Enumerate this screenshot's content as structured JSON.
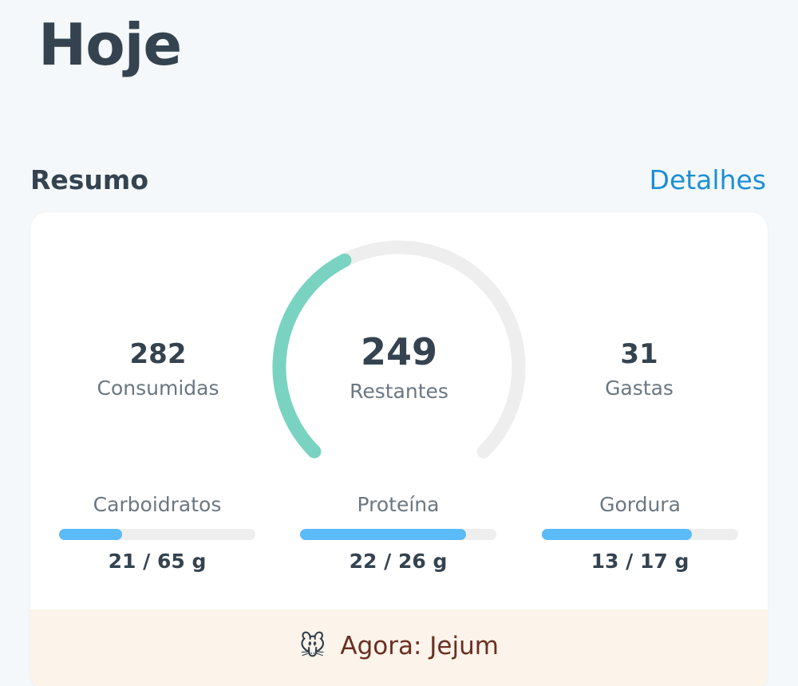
{
  "header": {
    "title": "Hoje"
  },
  "summary": {
    "title": "Resumo",
    "details_label": "Detalhes",
    "consumed": {
      "value": "282",
      "label": "Consumidas"
    },
    "remaining": {
      "value": "249",
      "label": "Restantes"
    },
    "burned": {
      "value": "31",
      "label": "Gastas"
    },
    "gauge": {
      "progress": 0.4,
      "track_color": "#eeeeee",
      "fill_color": "#79d3c0"
    },
    "macros": [
      {
        "name": "Carboidratos",
        "amount": "21 / 65 g",
        "progress": 0.3231
      },
      {
        "name": "Proteína",
        "amount": "22 / 26 g",
        "progress": 0.8462
      },
      {
        "name": "Gordura",
        "amount": "13 / 17 g",
        "progress": 0.7647
      }
    ],
    "macro_bar_color": "#5bbaf8"
  },
  "fasting": {
    "icon": "mouse-face-icon",
    "icon_glyph": "🐭",
    "label": "Agora: Jejum"
  }
}
